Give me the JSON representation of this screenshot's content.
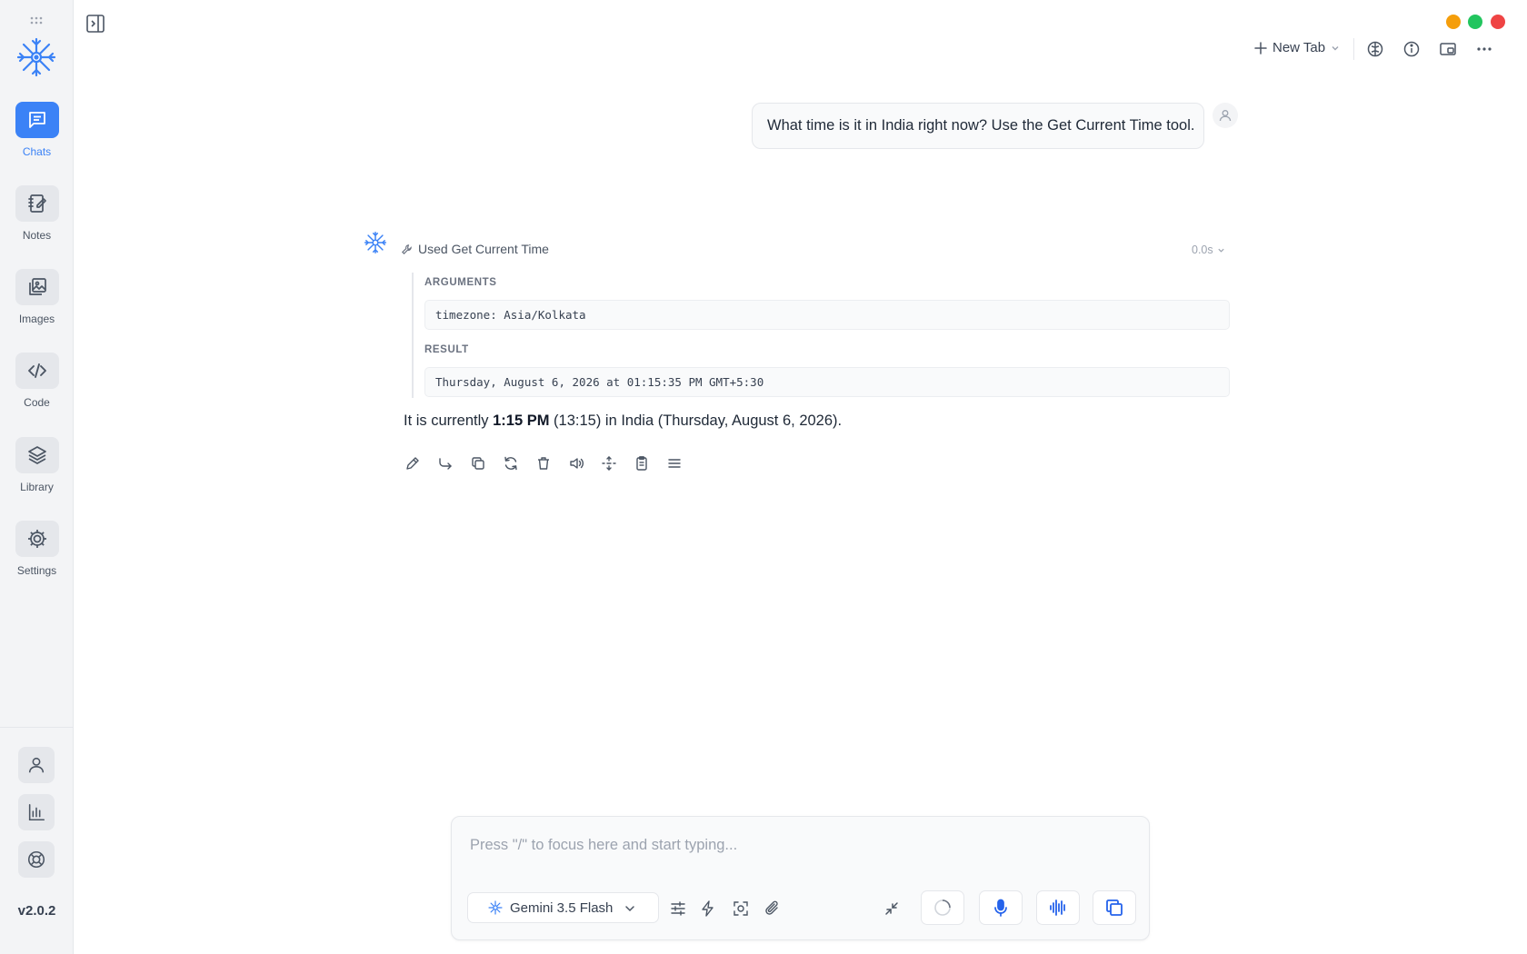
{
  "sidebar": {
    "items": [
      {
        "label": "Chats",
        "icon": "chat-icon",
        "active": true
      },
      {
        "label": "Notes",
        "icon": "notes-icon",
        "active": false
      },
      {
        "label": "Images",
        "icon": "images-icon",
        "active": false
      },
      {
        "label": "Code",
        "icon": "code-icon",
        "active": false
      },
      {
        "label": "Library",
        "icon": "layers-icon",
        "active": false
      },
      {
        "label": "Settings",
        "icon": "gear-icon",
        "active": false
      }
    ],
    "bottom": [
      "user-icon",
      "chart-icon",
      "lifebuoy-icon"
    ],
    "version": "v2.0.2"
  },
  "topbar": {
    "new_tab_label": "New Tab",
    "icons": [
      "brain-icon",
      "info-icon",
      "window-icon",
      "more-icon"
    ],
    "traffic_lights": [
      "#f59e0b",
      "#22c55e",
      "#ef4444"
    ]
  },
  "conversation": {
    "user_message": "What time is it in India right now? Use the Get Current Time tool.",
    "tool_call": {
      "title": "Used Get Current Time",
      "duration": "0.0s",
      "arguments_label": "ARGUMENTS",
      "arguments": "timezone: Asia/Kolkata",
      "result_label": "RESULT",
      "result": "Thursday, August 6, 2026 at 01:15:35 PM GMT+5:30"
    },
    "answer": {
      "prefix": "It is currently ",
      "bold": "1:15 PM",
      "suffix": " (13:15) in India (Thursday, August 6, 2026)."
    },
    "actions": [
      "edit-icon",
      "forward-icon",
      "copy-icon",
      "regenerate-icon",
      "delete-icon",
      "speak-icon",
      "split-icon",
      "clipboard-icon",
      "menu-icon"
    ]
  },
  "composer": {
    "placeholder": "Press \"/\" to focus here and start typing...",
    "model": "Gemini 3.5 Flash"
  },
  "colors": {
    "accent": "#3b82f6",
    "sidebar_bg": "#f3f4f6"
  }
}
